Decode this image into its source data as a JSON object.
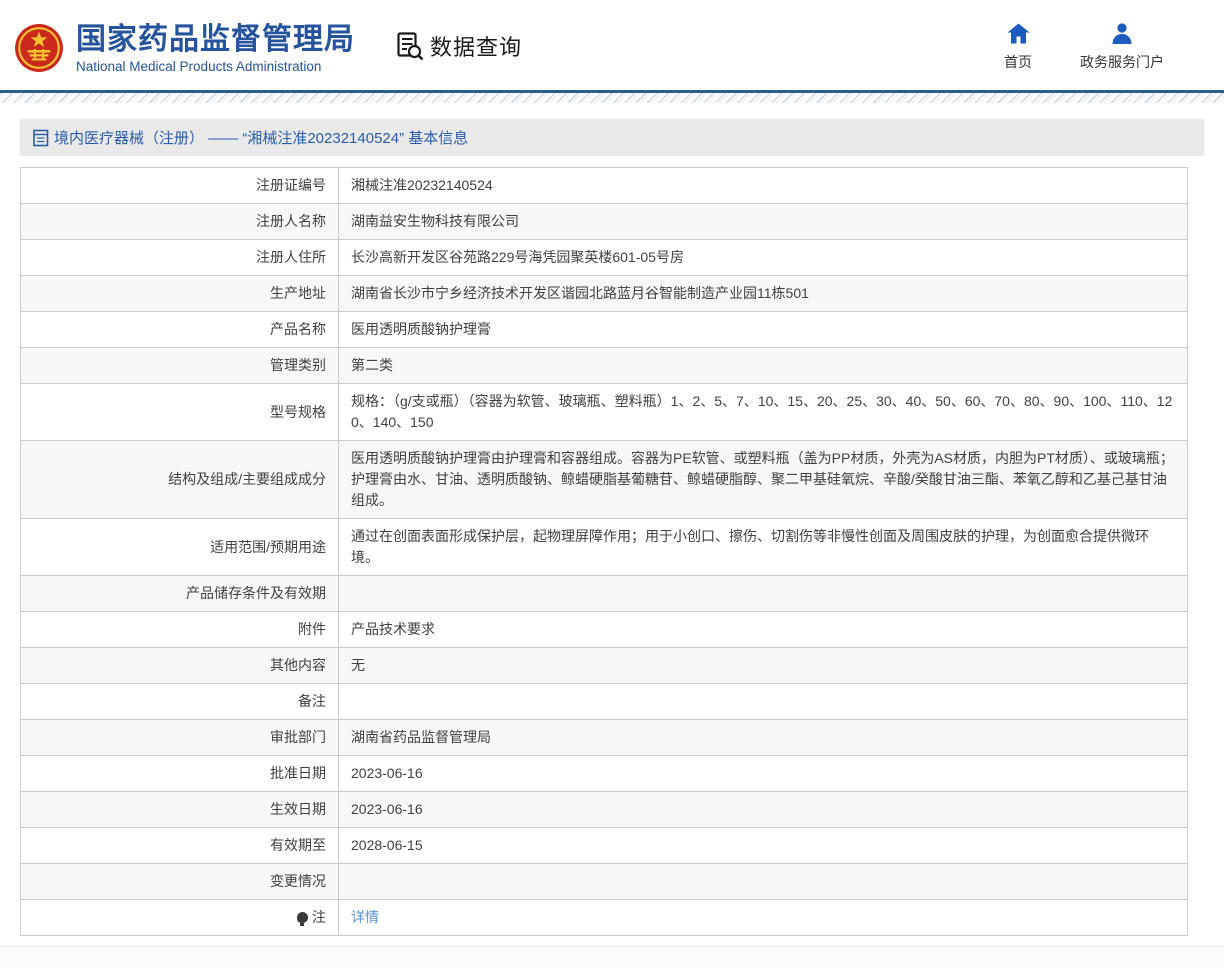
{
  "header": {
    "title_cn": "国家药品监督管理局",
    "title_en": "National Medical Products Administration",
    "section_label": "数据查询",
    "nav": [
      {
        "label": "首页",
        "icon": "home-icon"
      },
      {
        "label": "政务服务门户",
        "icon": "user-icon"
      }
    ]
  },
  "breadcrumb": {
    "text": "境内医疗器械（注册） —— “湘械注准20232140524” 基本信息"
  },
  "colors": {
    "brand_blue": "#26549C",
    "icon_blue": "#1E5BBF",
    "breadcrumb_text_blue": "#2A5CAA",
    "link_blue": "#5693D6",
    "divider_blue": "#2C5F87",
    "alt_row_gray": "#F7F7F7",
    "emblem_red": "#C92A1D",
    "emblem_gold": "#F8C431"
  },
  "table": {
    "rows": [
      {
        "label": "注册证编号",
        "value": "湘械注准20232140524"
      },
      {
        "label": "注册人名称",
        "value": "湖南益安生物科技有限公司"
      },
      {
        "label": "注册人住所",
        "value": "长沙高新开发区谷苑路229号海凭园聚英楼601-05号房"
      },
      {
        "label": "生产地址",
        "value": "湖南省长沙市宁乡经济技术开发区谐园北路蓝月谷智能制造产业园11栋501"
      },
      {
        "label": "产品名称",
        "value": "医用透明质酸钠护理膏"
      },
      {
        "label": "管理类别",
        "value": "第二类"
      },
      {
        "label": "型号规格",
        "value": "规格：（g/支或瓶）（容器为软管、玻璃瓶、塑料瓶）1、2、5、7、10、15、20、25、30、40、50、60、70、80、90、100、110、120、140、150"
      },
      {
        "label": "结构及组成/主要组成成分",
        "value": "医用透明质酸钠护理膏由护理膏和容器组成。容器为PE软管、或塑料瓶（盖为PP材质，外壳为AS材质，内胆为PT材质）、或玻璃瓶；护理膏由水、甘油、透明质酸钠、鲸蜡硬脂基葡糖苷、鲸蜡硬脂醇、聚二甲基硅氧烷、辛酸/癸酸甘油三酯、苯氧乙醇和乙基己基甘油组成。"
      },
      {
        "label": "适用范围/预期用途",
        "value": "通过在创面表面形成保护层，起物理屏障作用；用于小创口、擦伤、切割伤等非慢性创面及周围皮肤的护理，为创面愈合提供微环境。"
      },
      {
        "label": "产品储存条件及有效期",
        "value": ""
      },
      {
        "label": "附件",
        "value": "产品技术要求"
      },
      {
        "label": "其他内容",
        "value": "无"
      },
      {
        "label": "备注",
        "value": ""
      },
      {
        "label": "审批部门",
        "value": "湖南省药品监督管理局"
      },
      {
        "label": "批准日期",
        "value": "2023-06-16"
      },
      {
        "label": "生效日期",
        "value": "2023-06-16"
      },
      {
        "label": "有效期至",
        "value": "2028-06-15"
      },
      {
        "label": "变更情况",
        "value": ""
      },
      {
        "label": "注",
        "label_icon": "lightbulb-icon",
        "value": "详情",
        "value_is_link": true
      }
    ]
  }
}
